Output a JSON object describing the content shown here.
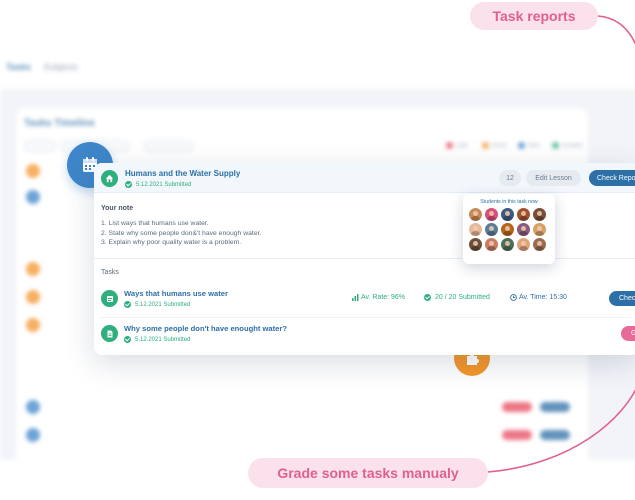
{
  "callouts": {
    "top": "Task reports",
    "bottom": "Grade some tasks manualy"
  },
  "background": {
    "tabs": [
      "Tasks",
      "Subjects"
    ],
    "card_title": "Tasks Timeline",
    "legend": [
      {
        "label": "Late",
        "color": "#e84a5f"
      },
      {
        "label": "Done",
        "color": "#f3962b"
      },
      {
        "label": "New",
        "color": "#3e86c9"
      },
      {
        "label": "Graded",
        "color": "#2eaf7d"
      }
    ]
  },
  "lesson": {
    "title": "Humans and the Water Supply",
    "date": "5.12.2021",
    "status": "Submitted",
    "count": "12",
    "edit_label": "Edit Lesson",
    "check_label": "Check Reports",
    "note_label": "Your note",
    "notes": [
      "1. List ways that humans use water.",
      "2. State why some people don&'t have enough water.",
      "3. Explain why poor quality water is a problem."
    ],
    "tasks_label": "Tasks"
  },
  "tasks": [
    {
      "title": "Ways that humans use water",
      "date": "5.12.2021",
      "status": "Submitted",
      "avg_rate": "Av. Rate: 96%",
      "submitted": "20 / 20 Submitted",
      "avg_time": "Av. Time: 15:30",
      "button": "Check",
      "button_color": "#2d6fa7"
    },
    {
      "title": "Why some people don't have enought water?",
      "date": "5.12.2021",
      "status": "Submitted",
      "button": "Grade",
      "button_color": "#e86a9a"
    }
  ],
  "students_popup": {
    "title": "Students in this task now",
    "avatar_colors": [
      "#c98a5a",
      "#d94f7c",
      "#3d5a80",
      "#a0522d",
      "#7a4e3a",
      "#e6b89c",
      "#5b7c99",
      "#b5651d",
      "#8c5a7a",
      "#d9a066",
      "#6b4f3a",
      "#c97b63",
      "#4e6e58",
      "#e0a37a",
      "#9a6b4f"
    ]
  }
}
